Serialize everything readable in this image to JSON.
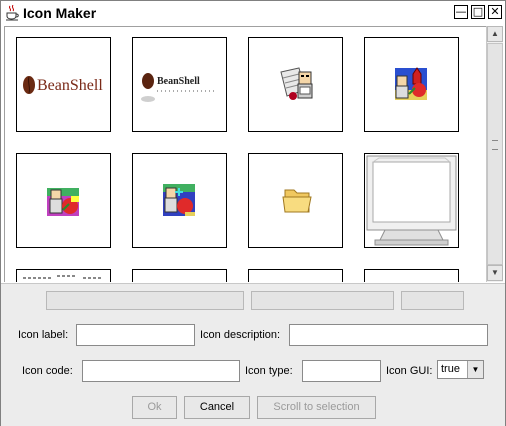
{
  "window": {
    "title": "Icon Maker",
    "min_glyph": "—",
    "max_glyph": "□",
    "close_glyph": "✕"
  },
  "tiles": [
    {
      "name": "beanshell-logo",
      "caption": "BeanShell"
    },
    {
      "name": "beanshell-small-logo",
      "caption": "BeanShell"
    },
    {
      "name": "scroll-computer-icon"
    },
    {
      "name": "rocket-computer-icon"
    },
    {
      "name": "workspace-person-icon"
    },
    {
      "name": "workspace-person-icon"
    },
    {
      "name": "folder-icon"
    },
    {
      "name": "monitor-icon"
    }
  ],
  "scrollbar": {
    "up": "▲",
    "down": "▼"
  },
  "form": {
    "icon_label": {
      "label": "Icon label:",
      "value": ""
    },
    "icon_description": {
      "label": "Icon description:",
      "value": ""
    },
    "icon_code": {
      "label": "Icon code:",
      "value": ""
    },
    "icon_type": {
      "label": "Icon type:",
      "value": ""
    },
    "icon_gui": {
      "label": "Icon GUI:",
      "value": "true",
      "arrow": "▼"
    }
  },
  "buttons": {
    "ok": "Ok",
    "cancel": "Cancel",
    "scroll": "Scroll to selection"
  }
}
